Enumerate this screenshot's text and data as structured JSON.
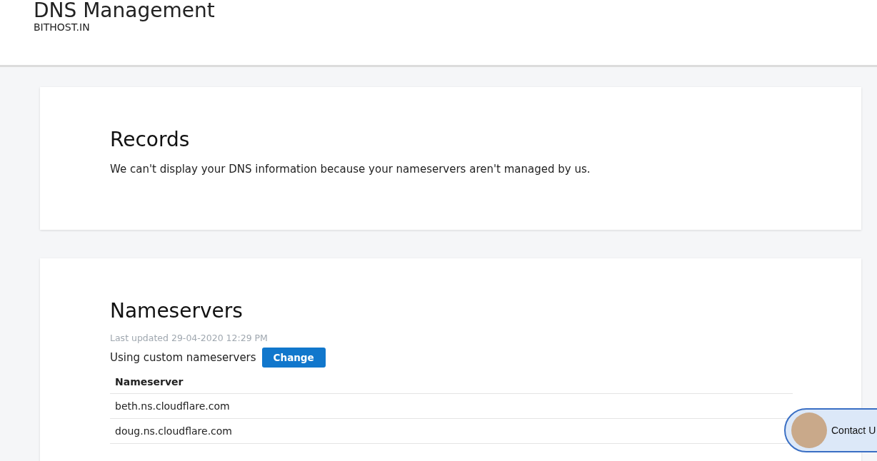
{
  "header": {
    "title": "DNS Management",
    "domain": "BITHOST.IN"
  },
  "records": {
    "heading": "Records",
    "message": "We can't display your DNS information because your nameservers aren't managed by us."
  },
  "nameservers": {
    "heading": "Nameservers",
    "last_updated": "Last updated 29-04-2020 12:29 PM",
    "status": "Using custom nameservers",
    "change_button": "Change",
    "table": {
      "columns": [
        "Nameserver"
      ],
      "rows": [
        "beth.ns.cloudflare.com",
        "doug.ns.cloudflare.com"
      ]
    }
  },
  "chat_widget": {
    "label": "Contact U"
  }
}
